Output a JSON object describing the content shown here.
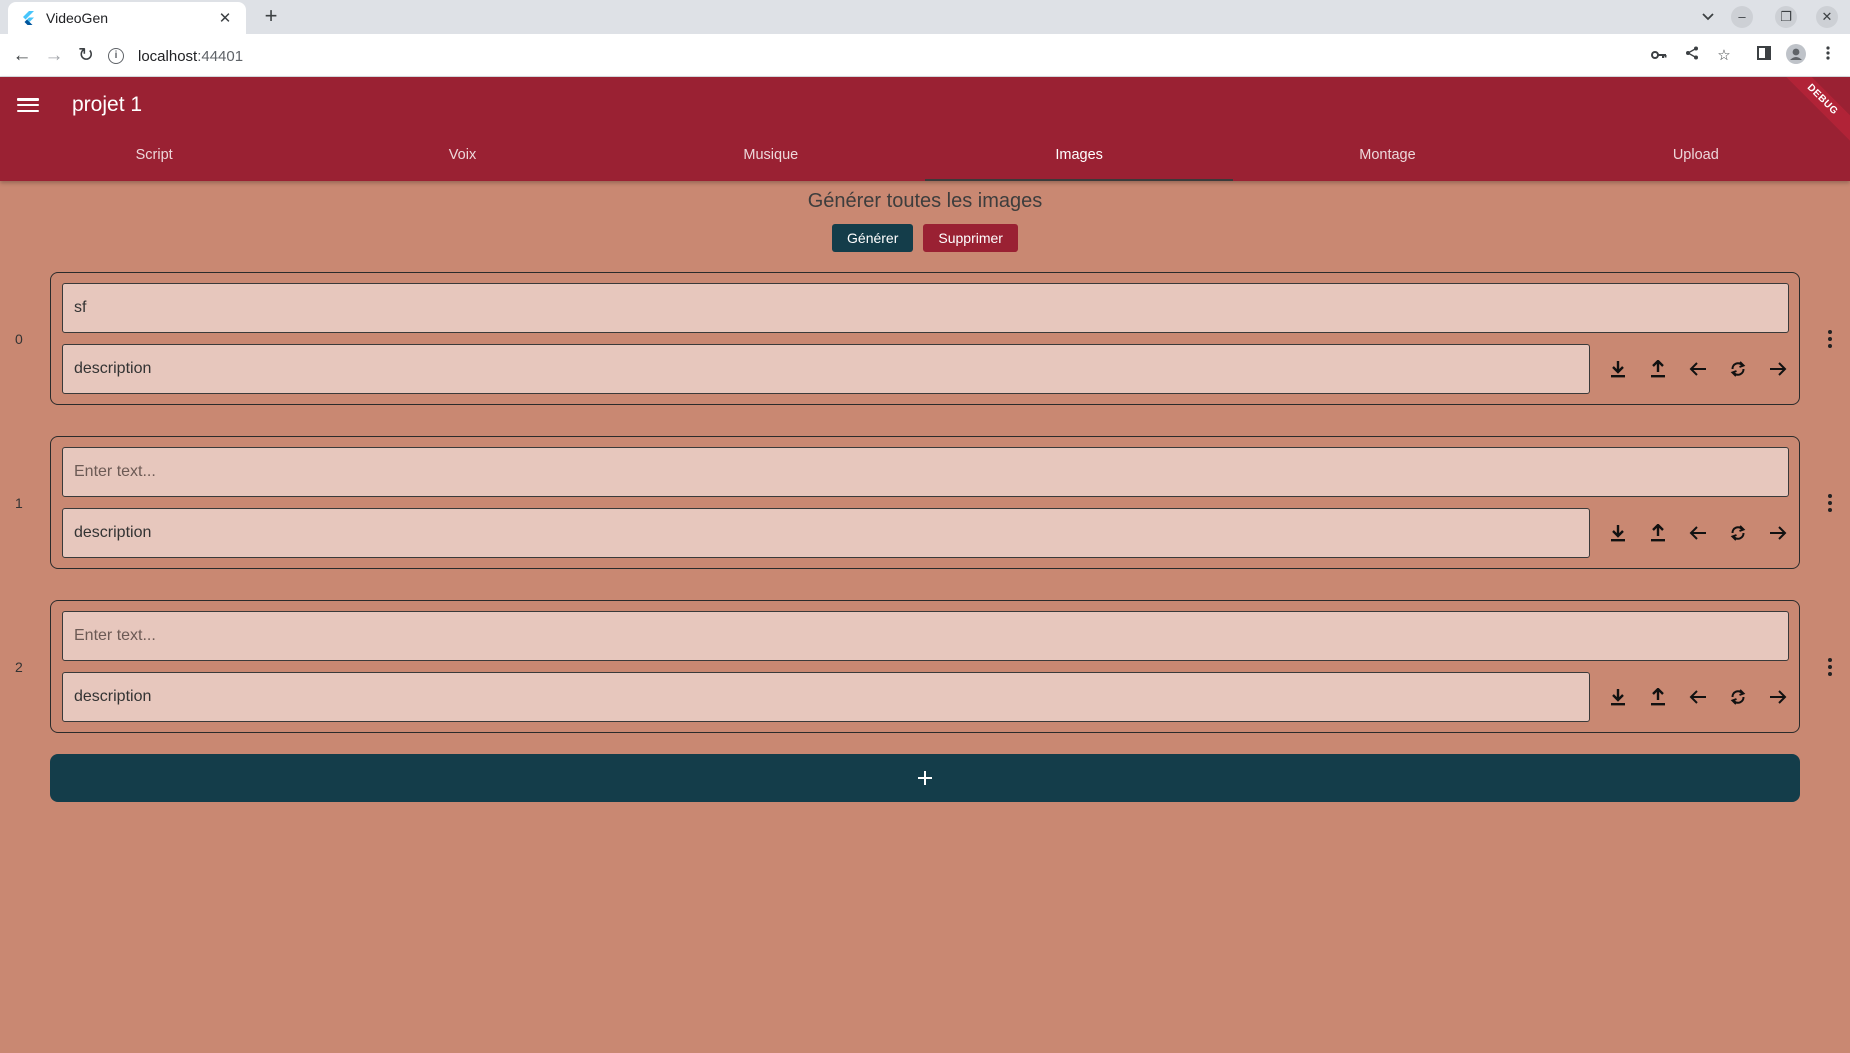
{
  "browser": {
    "tab_title": "VideoGen",
    "tab_close": "✕",
    "new_tab": "+",
    "url_host": "localhost",
    "url_port": ":44401"
  },
  "app": {
    "title": "projet 1",
    "debug_label": "DEBUG",
    "tabs": [
      "Script",
      "Voix",
      "Musique",
      "Images",
      "Montage",
      "Upload"
    ],
    "active_tab": "Images",
    "accent_color": "#9a2133",
    "background_color": "#c98872",
    "primary_button_color": "#143d4a"
  },
  "images_section": {
    "title": "Générer toutes les images",
    "generate_label": "Générer",
    "delete_label": "Supprimer"
  },
  "items": [
    {
      "index": "0",
      "text": "sf",
      "text_placeholder": "Enter text...",
      "description": "description"
    },
    {
      "index": "1",
      "text": "",
      "text_placeholder": "Enter text...",
      "description": "description"
    },
    {
      "index": "2",
      "text": "",
      "text_placeholder": "Enter text...",
      "description": "description"
    }
  ],
  "item_actions": [
    "download-icon",
    "upload-icon",
    "arrow-left-icon",
    "refresh-icon",
    "arrow-right-icon"
  ],
  "add_button_icon": "plus-icon"
}
